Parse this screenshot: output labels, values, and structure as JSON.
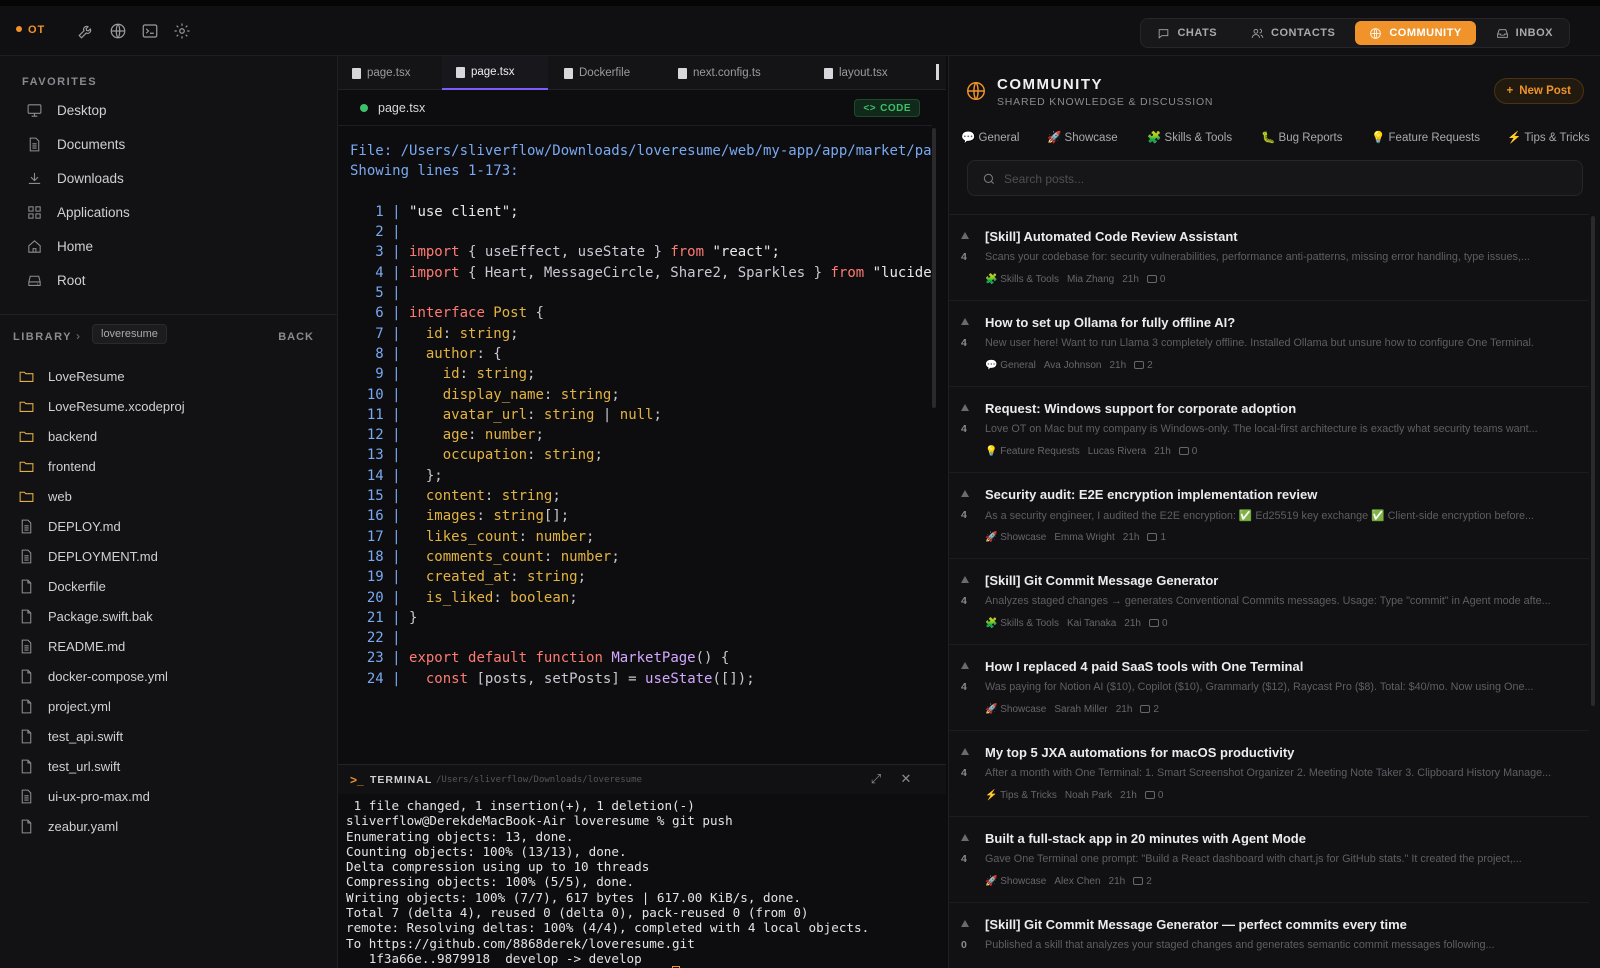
{
  "topbar": {
    "brand": "OT",
    "tools": [
      "wrench-icon",
      "globe-icon",
      "terminal-icon",
      "gear-icon"
    ],
    "nav": [
      {
        "label": "CHATS",
        "icon": "chat-icon",
        "active": false
      },
      {
        "label": "CONTACTS",
        "icon": "contacts-icon",
        "active": false
      },
      {
        "label": "COMMUNITY",
        "icon": "globe-icon",
        "active": true
      },
      {
        "label": "INBOX",
        "icon": "inbox-icon",
        "active": false
      }
    ],
    "accent": "#f0932b"
  },
  "sidebar": {
    "favorites_title": "FAVORITES",
    "favorites": [
      {
        "label": "Desktop",
        "icon": "monitor-icon"
      },
      {
        "label": "Documents",
        "icon": "document-icon"
      },
      {
        "label": "Downloads",
        "icon": "download-icon"
      },
      {
        "label": "Applications",
        "icon": "grid-icon"
      },
      {
        "label": "Home",
        "icon": "home-icon"
      },
      {
        "label": "Root",
        "icon": "drive-icon"
      }
    ],
    "library_title": "LIBRARY",
    "library_crumb": "loveresume",
    "back_label": "BACK",
    "files": [
      {
        "name": "LoveResume",
        "type": "folder"
      },
      {
        "name": "LoveResume.xcodeproj",
        "type": "folder"
      },
      {
        "name": "backend",
        "type": "folder"
      },
      {
        "name": "frontend",
        "type": "folder"
      },
      {
        "name": "web",
        "type": "folder"
      },
      {
        "name": "DEPLOY.md",
        "type": "text"
      },
      {
        "name": "DEPLOYMENT.md",
        "type": "text"
      },
      {
        "name": "Dockerfile",
        "type": "file"
      },
      {
        "name": "Package.swift.bak",
        "type": "file"
      },
      {
        "name": "README.md",
        "type": "text"
      },
      {
        "name": "docker-compose.yml",
        "type": "file"
      },
      {
        "name": "project.yml",
        "type": "file"
      },
      {
        "name": "test_api.swift",
        "type": "file"
      },
      {
        "name": "test_url.swift",
        "type": "file"
      },
      {
        "name": "ui-ux-pro-max.md",
        "type": "text"
      },
      {
        "name": "zeabur.yaml",
        "type": "file"
      }
    ]
  },
  "editor": {
    "tabs": [
      {
        "label": "page.tsx",
        "active": false
      },
      {
        "label": "page.tsx",
        "active": true
      },
      {
        "label": "Dockerfile",
        "active": false
      },
      {
        "label": "next.config.ts",
        "active": false
      },
      {
        "label": "layout.tsx",
        "active": false
      }
    ],
    "filename": "page.tsx",
    "badge": "CODE",
    "file_line": "File: /Users/sliverflow/Downloads/loveresume/web/my-app/app/market/page.tsx",
    "showing_line": "Showing lines 1-173:",
    "lines": [
      [
        [
          "st",
          "\"use client\";"
        ]
      ],
      [],
      [
        [
          "kw",
          "import"
        ],
        [
          "pl",
          " { useEffect, useState } "
        ],
        [
          "kw",
          "from"
        ],
        [
          "st",
          " \"react\";"
        ]
      ],
      [
        [
          "kw",
          "import"
        ],
        [
          "pl",
          " { Heart, MessageCircle, Share2, Sparkles } "
        ],
        [
          "kw",
          "from"
        ],
        [
          "st",
          " \"lucide-react\";"
        ]
      ],
      [],
      [
        [
          "kw",
          "interface"
        ],
        [
          "ty",
          " Post"
        ],
        [
          "pl",
          " {"
        ]
      ],
      [
        [
          "pl",
          "  "
        ],
        [
          "id",
          "id"
        ],
        [
          "pl",
          ": "
        ],
        [
          "ty",
          "string"
        ],
        [
          "pl",
          ";"
        ]
      ],
      [
        [
          "pl",
          "  "
        ],
        [
          "id",
          "author"
        ],
        [
          "pl",
          ": {"
        ]
      ],
      [
        [
          "pl",
          "    "
        ],
        [
          "id",
          "id"
        ],
        [
          "pl",
          ": "
        ],
        [
          "ty",
          "string"
        ],
        [
          "pl",
          ";"
        ]
      ],
      [
        [
          "pl",
          "    "
        ],
        [
          "id",
          "display_name"
        ],
        [
          "pl",
          ": "
        ],
        [
          "ty",
          "string"
        ],
        [
          "pl",
          ";"
        ]
      ],
      [
        [
          "pl",
          "    "
        ],
        [
          "id",
          "avatar_url"
        ],
        [
          "pl",
          ": "
        ],
        [
          "ty",
          "string"
        ],
        [
          "pl",
          " | "
        ],
        [
          "ty",
          "null"
        ],
        [
          "pl",
          ";"
        ]
      ],
      [
        [
          "pl",
          "    "
        ],
        [
          "id",
          "age"
        ],
        [
          "pl",
          ": "
        ],
        [
          "ty",
          "number"
        ],
        [
          "pl",
          ";"
        ]
      ],
      [
        [
          "pl",
          "    "
        ],
        [
          "id",
          "occupation"
        ],
        [
          "pl",
          ": "
        ],
        [
          "ty",
          "string"
        ],
        [
          "pl",
          ";"
        ]
      ],
      [
        [
          "pl",
          "  };"
        ]
      ],
      [
        [
          "pl",
          "  "
        ],
        [
          "id",
          "content"
        ],
        [
          "pl",
          ": "
        ],
        [
          "ty",
          "string"
        ],
        [
          "pl",
          ";"
        ]
      ],
      [
        [
          "pl",
          "  "
        ],
        [
          "id",
          "images"
        ],
        [
          "pl",
          ": "
        ],
        [
          "ty",
          "string"
        ],
        [
          "pl",
          "[];"
        ]
      ],
      [
        [
          "pl",
          "  "
        ],
        [
          "id",
          "likes_count"
        ],
        [
          "pl",
          ": "
        ],
        [
          "ty",
          "number"
        ],
        [
          "pl",
          ";"
        ]
      ],
      [
        [
          "pl",
          "  "
        ],
        [
          "id",
          "comments_count"
        ],
        [
          "pl",
          ": "
        ],
        [
          "ty",
          "number"
        ],
        [
          "pl",
          ";"
        ]
      ],
      [
        [
          "pl",
          "  "
        ],
        [
          "id",
          "created_at"
        ],
        [
          "pl",
          ": "
        ],
        [
          "ty",
          "string"
        ],
        [
          "pl",
          ";"
        ]
      ],
      [
        [
          "pl",
          "  "
        ],
        [
          "id",
          "is_liked"
        ],
        [
          "pl",
          ": "
        ],
        [
          "ty",
          "boolean"
        ],
        [
          "pl",
          ";"
        ]
      ],
      [
        [
          "pl",
          "}"
        ]
      ],
      [],
      [
        [
          "kw",
          "export default function"
        ],
        [
          "fn",
          " MarketPage"
        ],
        [
          "pl",
          "() {"
        ]
      ],
      [
        [
          "pl",
          "  "
        ],
        [
          "kw",
          "const"
        ],
        [
          "pl",
          " [posts, setPosts] = "
        ],
        [
          "fn",
          "useState"
        ],
        [
          "pl",
          "([]);"
        ]
      ]
    ]
  },
  "terminal": {
    "title": "TERMINAL",
    "path": "/Users/sliverflow/Downloads/loveresume",
    "lines": [
      " 1 file changed, 1 insertion(+), 1 deletion(-)",
      "sliverflow@DerekdeMacBook-Air loveresume % git push",
      "Enumerating objects: 13, done.",
      "Counting objects: 100% (13/13), done.",
      "Delta compression using up to 10 threads",
      "Compressing objects: 100% (5/5), done.",
      "Writing objects: 100% (7/7), 617 bytes | 617.00 KiB/s, done.",
      "Total 7 (delta 4), reused 0 (delta 0), pack-reused 0 (from 0)",
      "remote: Resolving deltas: 100% (4/4), completed with 4 local objects.",
      "To https://github.com/8868derek/loveresume.git",
      "   1f3a66e..9879918  develop -> develop"
    ],
    "prompt": "sliverflow@DerekdeMacBook-Air loveresume % "
  },
  "community": {
    "title": "COMMUNITY",
    "subtitle": "SHARED KNOWLEDGE & DISCUSSION",
    "new_post_label": "New Post",
    "categories": [
      {
        "label": "General",
        "emoji": "💬"
      },
      {
        "label": "Showcase",
        "emoji": "🚀"
      },
      {
        "label": "Skills & Tools",
        "emoji": "🧩"
      },
      {
        "label": "Bug Reports",
        "emoji": "🐛"
      },
      {
        "label": "Feature Requests",
        "emoji": "💡"
      },
      {
        "label": "Tips & Tricks",
        "emoji": "⚡"
      }
    ],
    "search_placeholder": "Search posts...",
    "posts": [
      {
        "votes": "4",
        "title": "[Skill] Automated Code Review Assistant",
        "snippet": "Scans your codebase for: security vulnerabilities, performance anti-patterns, missing error handling, type issues,...",
        "cat_emoji": "🧩",
        "category": "Skills & Tools",
        "author": "Mia Zhang",
        "time": "21h",
        "comments": "0"
      },
      {
        "votes": "4",
        "title": "How to set up Ollama for fully offline AI?",
        "snippet": "New user here! Want to run Llama 3 completely offline. Installed Ollama but unsure how to configure One Terminal.",
        "cat_emoji": "💬",
        "category": "General",
        "author": "Ava Johnson",
        "time": "21h",
        "comments": "2"
      },
      {
        "votes": "4",
        "title": "Request: Windows support for corporate adoption",
        "snippet": "Love OT on Mac but my company is Windows-only. The local-first architecture is exactly what security teams want...",
        "cat_emoji": "💡",
        "category": "Feature Requests",
        "author": "Lucas Rivera",
        "time": "21h",
        "comments": "0"
      },
      {
        "votes": "4",
        "title": "Security audit: E2E encryption implementation review",
        "snippet": "As a security engineer, I audited the E2E encryption: ✅ Ed25519 key exchange ✅ Client-side encryption before...",
        "cat_emoji": "🚀",
        "category": "Showcase",
        "author": "Emma Wright",
        "time": "21h",
        "comments": "1"
      },
      {
        "votes": "4",
        "title": "[Skill] Git Commit Message Generator",
        "snippet": "Analyzes staged changes → generates Conventional Commits messages. Usage: Type \"commit\" in Agent mode afte...",
        "cat_emoji": "🧩",
        "category": "Skills & Tools",
        "author": "Kai Tanaka",
        "time": "21h",
        "comments": "0"
      },
      {
        "votes": "4",
        "title": "How I replaced 4 paid SaaS tools with One Terminal",
        "snippet": "Was paying for Notion AI ($10), Copilot ($10), Grammarly ($12), Raycast Pro ($8). Total: $40/mo. Now using One...",
        "cat_emoji": "🚀",
        "category": "Showcase",
        "author": "Sarah Miller",
        "time": "21h",
        "comments": "2"
      },
      {
        "votes": "4",
        "title": "My top 5 JXA automations for macOS productivity",
        "snippet": "After a month with One Terminal: 1. Smart Screenshot Organizer 2. Meeting Note Taker 3. Clipboard History Manage...",
        "cat_emoji": "⚡",
        "category": "Tips & Tricks",
        "author": "Noah Park",
        "time": "21h",
        "comments": "0"
      },
      {
        "votes": "4",
        "title": "Built a full-stack app in 20 minutes with Agent Mode",
        "snippet": "Gave One Terminal one prompt: \"Build a React dashboard with chart.js for GitHub stats.\" It created the project,...",
        "cat_emoji": "🚀",
        "category": "Showcase",
        "author": "Alex Chen",
        "time": "21h",
        "comments": "2"
      },
      {
        "votes": "0",
        "title": "[Skill] Git Commit Message Generator — perfect commits every time",
        "snippet": "Published a skill that analyzes your staged changes and generates semantic commit messages following...",
        "cat_emoji": "",
        "category": "",
        "author": "",
        "time": "",
        "comments": ""
      }
    ]
  }
}
